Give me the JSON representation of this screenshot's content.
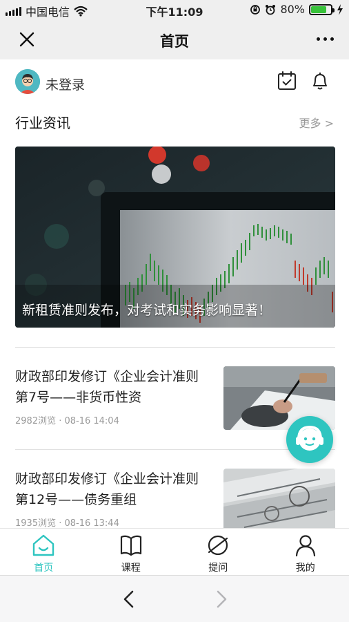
{
  "status_bar": {
    "carrier": "中国电信",
    "time": "下午11:09",
    "battery_percent": "80%",
    "battery_level": 0.8,
    "icons": [
      "signal-icon",
      "wifi-icon",
      "rotation-lock-icon",
      "alarm-icon",
      "battery-icon",
      "charging-icon"
    ]
  },
  "navbar": {
    "title": "首页",
    "icons": [
      "close-icon",
      "more-icon"
    ]
  },
  "user": {
    "name": "未登录",
    "icons": [
      "avatar",
      "calendar-check-icon",
      "bell-icon"
    ]
  },
  "section": {
    "title": "行业资讯",
    "more": "更多 >"
  },
  "hero": {
    "caption": "新租赁准则发布，对考试和实务影响显著！"
  },
  "news": [
    {
      "title": "财政部印发修订《企业会计准则第7号——非货币性资",
      "meta": "2982浏览 · 08-16 14:04",
      "thumb_icon": "writing-hand-image"
    },
    {
      "title": "财政部印发修订《企业会计准则第12号——债务重组",
      "meta": "1935浏览 · 08-16 13:44",
      "thumb_icon": "banknotes-image"
    }
  ],
  "tabs": [
    {
      "label": "首页",
      "icon": "home-icon",
      "active": true
    },
    {
      "label": "课程",
      "icon": "book-icon",
      "active": false
    },
    {
      "label": "提问",
      "icon": "planet-icon",
      "active": false
    },
    {
      "label": "我的",
      "icon": "user-icon",
      "active": false
    }
  ],
  "browser": {
    "icons": [
      "back-chevron-icon",
      "forward-chevron-icon"
    ]
  },
  "colors": {
    "accent": "#2ec5c0",
    "status_bg": "#efefef",
    "battery_green": "#38c23a"
  }
}
